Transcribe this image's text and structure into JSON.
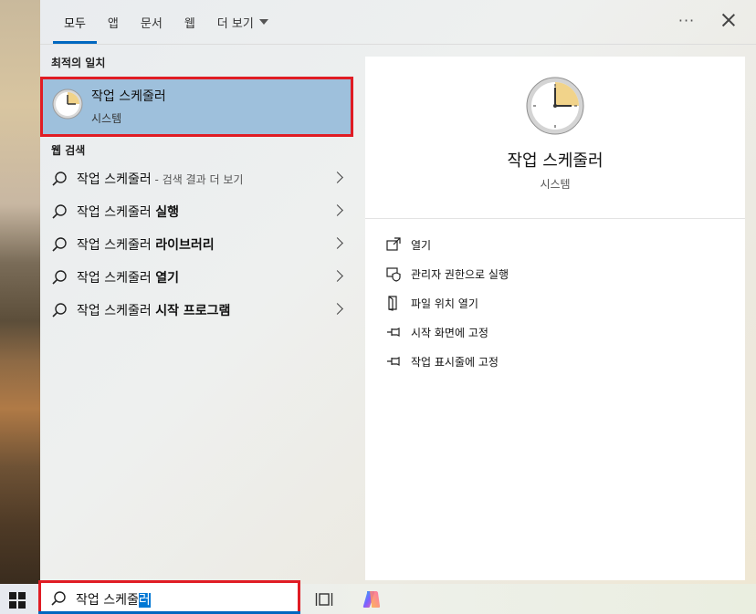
{
  "tabs": {
    "all": "모두",
    "apps": "앱",
    "documents": "문서",
    "web": "웹",
    "more": "더 보기"
  },
  "top_actions": {
    "more": "···"
  },
  "best_match": {
    "section_label": "최적의 일치",
    "title": "작업 스케줄러",
    "subtitle": "시스템"
  },
  "web_search": {
    "section_label": "웹 검색",
    "items": [
      {
        "prefix": "작업 스케줄러",
        "suffix": "",
        "muted": " - 검색 결과 더 보기"
      },
      {
        "prefix": "작업 스케줄러 ",
        "suffix": "실행",
        "muted": ""
      },
      {
        "prefix": "작업 스케줄러 ",
        "suffix": "라이브러리",
        "muted": ""
      },
      {
        "prefix": "작업 스케줄러 ",
        "suffix": "열기",
        "muted": ""
      },
      {
        "prefix": "작업 스케줄러 ",
        "suffix": "시작 프로그램",
        "muted": ""
      }
    ]
  },
  "detail": {
    "app_name": "작업 스케줄러",
    "app_type": "시스템",
    "actions": [
      {
        "label": "열기",
        "icon": "open-icon"
      },
      {
        "label": "관리자 권한으로 실행",
        "icon": "shield-icon"
      },
      {
        "label": "파일 위치 열기",
        "icon": "file-location-icon"
      },
      {
        "label": "시작 화면에 고정",
        "icon": "pin-icon"
      },
      {
        "label": "작업 표시줄에 고정",
        "icon": "pin-icon"
      }
    ]
  },
  "taskbar": {
    "search_text_main": "작업 스케줄",
    "search_text_selected": "러"
  },
  "colors": {
    "accent": "#0067c0",
    "highlight_border": "#e01c24",
    "selected_item_bg": "#9ec0dc"
  }
}
